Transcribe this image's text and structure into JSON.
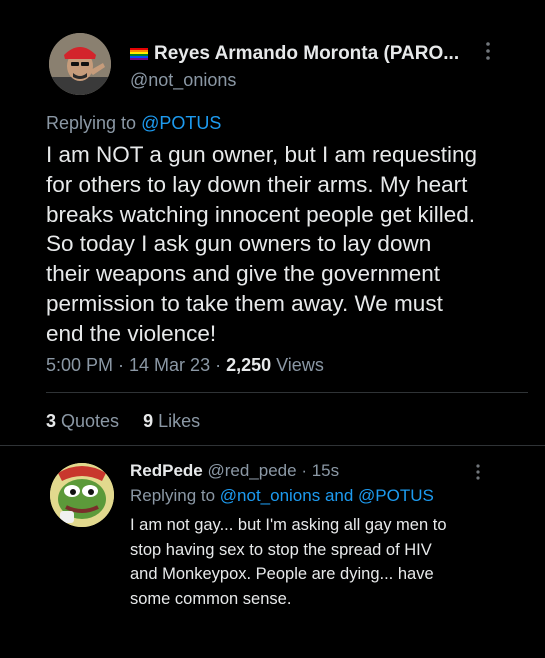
{
  "main_tweet": {
    "author_name": "Reyes Armando Moronta (PARO...",
    "author_handle": "@not_onions",
    "replying_prefix": "Replying to ",
    "replying_to": "@POTUS",
    "text_lines": [
      "I am NOT a gun owner, but I am requesting",
      "for others to lay down their arms. My heart",
      "breaks watching innocent people get killed.",
      "So today I ask gun owners to lay down",
      "their weapons and give the government",
      "permission to take them away. We must",
      "end the violence!"
    ],
    "time": "5:00 PM · 14 Mar 23 · ",
    "views_count": "2,250",
    "views_label": " Views",
    "quotes_count": "3",
    "quotes_label": " Quotes",
    "likes_count": "9",
    "likes_label": " Likes"
  },
  "reply_tweet": {
    "author_name": "RedPede",
    "author_handle": "@red_pede",
    "time": " · 15s",
    "replying_prefix": "Replying to ",
    "replying_to_1": "@not_onions",
    "replying_and": " and ",
    "replying_to_2": "@POTUS",
    "text_lines": [
      "I am not gay... but I'm asking all gay men to",
      "stop having sex to stop the spread of HIV",
      "and Monkeypox. People are dying... have",
      "some common sense."
    ]
  },
  "colors": {
    "background": "#000000",
    "text": "#e7e9ea",
    "muted": "#8b98a5",
    "link": "#1d9bf0",
    "divider": "#2f3336"
  }
}
